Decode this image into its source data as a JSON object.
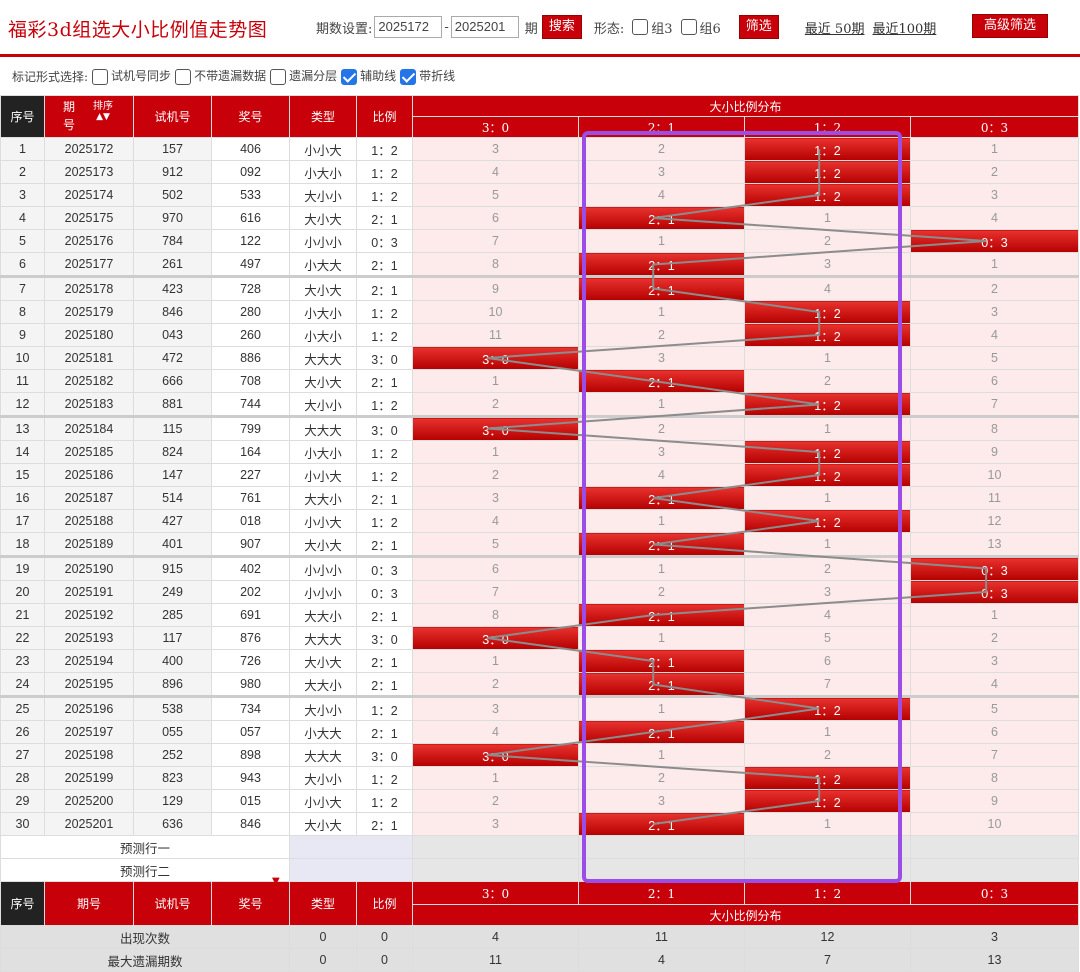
{
  "header": {
    "title": "福彩3d组选大小比例值走势图",
    "period_label": "期数设置:",
    "period_from": "2025172",
    "period_dash": "-",
    "period_to": "2025201",
    "period_unit": "期",
    "search_label": "搜索",
    "form_label": "形态:",
    "group3_label": "组3",
    "group6_label": "组6",
    "filter_label": "筛选",
    "recent50": "最近 50期",
    "recent100": "最近100期",
    "advanced_label": "高级筛选"
  },
  "marks": {
    "label": "标记形式选择:",
    "options": [
      {
        "label": "试机号同步",
        "checked": false
      },
      {
        "label": "不带遗漏数据",
        "checked": false
      },
      {
        "label": "遗漏分层",
        "checked": false
      },
      {
        "label": "辅助线",
        "checked": true
      },
      {
        "label": "带折线",
        "checked": true
      }
    ]
  },
  "table": {
    "head": {
      "seq": "序号",
      "period_top": "期",
      "period_bottom": "号",
      "sort": "排序",
      "trial": "试机号",
      "prize": "奖号",
      "type": "类型",
      "ratio": "比例",
      "dist": "大小比例分布",
      "cols": [
        "3：0",
        "2：1",
        "1：2",
        "0：3"
      ]
    },
    "rows": [
      {
        "seq": "1",
        "period": "2025172",
        "trial": "157",
        "prize": "406",
        "type": "小小大",
        "ratio": "1：2",
        "hit": 2,
        "miss": [
          "3",
          "2",
          "",
          "1"
        ]
      },
      {
        "seq": "2",
        "period": "2025173",
        "trial": "912",
        "prize": "092",
        "type": "小大小",
        "ratio": "1：2",
        "hit": 2,
        "miss": [
          "4",
          "3",
          "",
          "2"
        ]
      },
      {
        "seq": "3",
        "period": "2025174",
        "trial": "502",
        "prize": "533",
        "type": "大小小",
        "ratio": "1：2",
        "hit": 2,
        "miss": [
          "5",
          "4",
          "",
          "3"
        ]
      },
      {
        "seq": "4",
        "period": "2025175",
        "trial": "970",
        "prize": "616",
        "type": "大小大",
        "ratio": "2：1",
        "hit": 1,
        "miss": [
          "6",
          "",
          "1",
          "4"
        ]
      },
      {
        "seq": "5",
        "period": "2025176",
        "trial": "784",
        "prize": "122",
        "type": "小小小",
        "ratio": "0：3",
        "hit": 3,
        "miss": [
          "7",
          "1",
          "2",
          ""
        ]
      },
      {
        "seq": "6",
        "period": "2025177",
        "trial": "261",
        "prize": "497",
        "type": "小大大",
        "ratio": "2：1",
        "hit": 1,
        "miss": [
          "8",
          "",
          "3",
          "1"
        ]
      },
      {
        "seq": "7",
        "period": "2025178",
        "trial": "423",
        "prize": "728",
        "type": "大小大",
        "ratio": "2：1",
        "hit": 1,
        "miss": [
          "9",
          "",
          "4",
          "2"
        ]
      },
      {
        "seq": "8",
        "period": "2025179",
        "trial": "846",
        "prize": "280",
        "type": "小大小",
        "ratio": "1：2",
        "hit": 2,
        "miss": [
          "10",
          "1",
          "",
          "3"
        ]
      },
      {
        "seq": "9",
        "period": "2025180",
        "trial": "043",
        "prize": "260",
        "type": "小大小",
        "ratio": "1：2",
        "hit": 2,
        "miss": [
          "11",
          "2",
          "",
          "4"
        ]
      },
      {
        "seq": "10",
        "period": "2025181",
        "trial": "472",
        "prize": "886",
        "type": "大大大",
        "ratio": "3：0",
        "hit": 0,
        "miss": [
          "",
          "3",
          "1",
          "5"
        ]
      },
      {
        "seq": "11",
        "period": "2025182",
        "trial": "666",
        "prize": "708",
        "type": "大小大",
        "ratio": "2：1",
        "hit": 1,
        "miss": [
          "1",
          "",
          "2",
          "6"
        ]
      },
      {
        "seq": "12",
        "period": "2025183",
        "trial": "881",
        "prize": "744",
        "type": "大小小",
        "ratio": "1：2",
        "hit": 2,
        "miss": [
          "2",
          "1",
          "",
          "7"
        ]
      },
      {
        "seq": "13",
        "period": "2025184",
        "trial": "115",
        "prize": "799",
        "type": "大大大",
        "ratio": "3：0",
        "hit": 0,
        "miss": [
          "",
          "2",
          "1",
          "8"
        ]
      },
      {
        "seq": "14",
        "period": "2025185",
        "trial": "824",
        "prize": "164",
        "type": "小大小",
        "ratio": "1：2",
        "hit": 2,
        "miss": [
          "1",
          "3",
          "",
          "9"
        ]
      },
      {
        "seq": "15",
        "period": "2025186",
        "trial": "147",
        "prize": "227",
        "type": "小小大",
        "ratio": "1：2",
        "hit": 2,
        "miss": [
          "2",
          "4",
          "",
          "10"
        ]
      },
      {
        "seq": "16",
        "period": "2025187",
        "trial": "514",
        "prize": "761",
        "type": "大大小",
        "ratio": "2：1",
        "hit": 1,
        "miss": [
          "3",
          "",
          "1",
          "11"
        ]
      },
      {
        "seq": "17",
        "period": "2025188",
        "trial": "427",
        "prize": "018",
        "type": "小小大",
        "ratio": "1：2",
        "hit": 2,
        "miss": [
          "4",
          "1",
          "",
          "12"
        ]
      },
      {
        "seq": "18",
        "period": "2025189",
        "trial": "401",
        "prize": "907",
        "type": "大小大",
        "ratio": "2：1",
        "hit": 1,
        "miss": [
          "5",
          "",
          "1",
          "13"
        ]
      },
      {
        "seq": "19",
        "period": "2025190",
        "trial": "915",
        "prize": "402",
        "type": "小小小",
        "ratio": "0：3",
        "hit": 3,
        "miss": [
          "6",
          "1",
          "2",
          ""
        ]
      },
      {
        "seq": "20",
        "period": "2025191",
        "trial": "249",
        "prize": "202",
        "type": "小小小",
        "ratio": "0：3",
        "hit": 3,
        "miss": [
          "7",
          "2",
          "3",
          ""
        ]
      },
      {
        "seq": "21",
        "period": "2025192",
        "trial": "285",
        "prize": "691",
        "type": "大大小",
        "ratio": "2：1",
        "hit": 1,
        "miss": [
          "8",
          "",
          "4",
          "1"
        ]
      },
      {
        "seq": "22",
        "period": "2025193",
        "trial": "117",
        "prize": "876",
        "type": "大大大",
        "ratio": "3：0",
        "hit": 0,
        "miss": [
          "",
          "1",
          "5",
          "2"
        ]
      },
      {
        "seq": "23",
        "period": "2025194",
        "trial": "400",
        "prize": "726",
        "type": "大小大",
        "ratio": "2：1",
        "hit": 1,
        "miss": [
          "1",
          "",
          "6",
          "3"
        ]
      },
      {
        "seq": "24",
        "period": "2025195",
        "trial": "896",
        "prize": "980",
        "type": "大大小",
        "ratio": "2：1",
        "hit": 1,
        "miss": [
          "2",
          "",
          "7",
          "4"
        ]
      },
      {
        "seq": "25",
        "period": "2025196",
        "trial": "538",
        "prize": "734",
        "type": "大小小",
        "ratio": "1：2",
        "hit": 2,
        "miss": [
          "3",
          "1",
          "",
          "5"
        ]
      },
      {
        "seq": "26",
        "period": "2025197",
        "trial": "055",
        "prize": "057",
        "type": "小大大",
        "ratio": "2：1",
        "hit": 1,
        "miss": [
          "4",
          "",
          "1",
          "6"
        ]
      },
      {
        "seq": "27",
        "period": "2025198",
        "trial": "252",
        "prize": "898",
        "type": "大大大",
        "ratio": "3：0",
        "hit": 0,
        "miss": [
          "",
          "1",
          "2",
          "7"
        ]
      },
      {
        "seq": "28",
        "period": "2025199",
        "trial": "823",
        "prize": "943",
        "type": "大小小",
        "ratio": "1：2",
        "hit": 2,
        "miss": [
          "1",
          "2",
          "",
          "8"
        ]
      },
      {
        "seq": "29",
        "period": "2025200",
        "trial": "129",
        "prize": "015",
        "type": "小小大",
        "ratio": "1：2",
        "hit": 2,
        "miss": [
          "2",
          "3",
          "",
          "9"
        ]
      },
      {
        "seq": "30",
        "period": "2025201",
        "trial": "636",
        "prize": "846",
        "type": "大小大",
        "ratio": "2：1",
        "hit": 1,
        "miss": [
          "3",
          "",
          "1",
          "10"
        ]
      }
    ],
    "predict": [
      "预测行一",
      "预测行二"
    ],
    "foot": {
      "seq": "序号",
      "period": "期号",
      "trial": "试机号",
      "prize": "奖号",
      "type": "类型",
      "ratio": "比例",
      "dist": "大小比例分布"
    },
    "stats": [
      {
        "label": "出现次数",
        "type": "0",
        "ratio": "0",
        "vals": [
          "4",
          "11",
          "12",
          "3"
        ]
      },
      {
        "label": "最大遗漏期数",
        "type": "0",
        "ratio": "0",
        "vals": [
          "11",
          "4",
          "7",
          "13"
        ]
      }
    ]
  },
  "colors": {
    "brand": "#c8000a",
    "highlight": "#9b4de8",
    "line": "#8c8c8c"
  }
}
